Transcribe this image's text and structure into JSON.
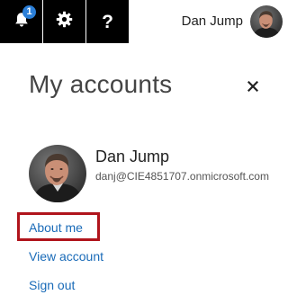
{
  "topbar": {
    "notifications": {
      "icon": "bell-icon",
      "badge_count": "1"
    },
    "settings": {
      "icon": "gear-icon"
    },
    "help": {
      "icon": "help-icon",
      "glyph": "?"
    },
    "user_name": "Dan Jump"
  },
  "panel": {
    "title": "My accounts",
    "close_icon": "close-icon",
    "profile": {
      "name": "Dan Jump",
      "email": "danj@CIE4851707.onmicrosoft.com"
    },
    "links": {
      "about_me": "About me",
      "view_account": "View account",
      "sign_out": "Sign out"
    }
  },
  "colors": {
    "topbar_dark": "#000000",
    "badge": "#2b7fd8",
    "link": "#1a6bb8",
    "highlight": "#b0141c"
  }
}
